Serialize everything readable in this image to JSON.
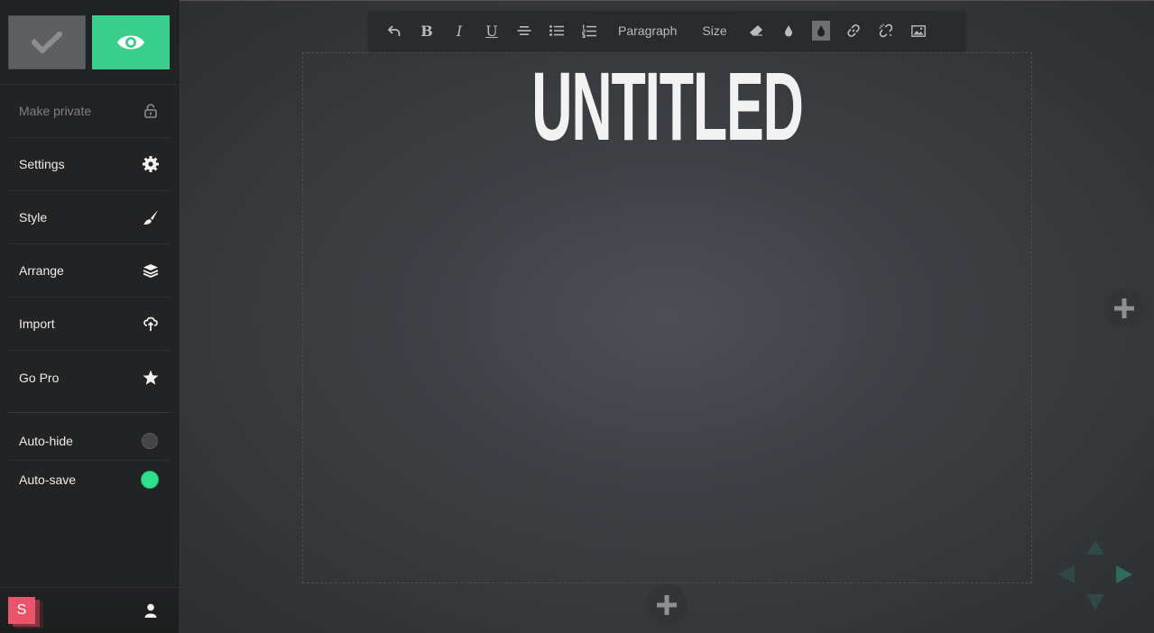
{
  "sidebar": {
    "menu": [
      {
        "label": "Make private",
        "icon": "lock-icon"
      },
      {
        "label": "Settings",
        "icon": "gear-icon"
      },
      {
        "label": "Style",
        "icon": "brush-icon"
      },
      {
        "label": "Arrange",
        "icon": "layers-icon"
      },
      {
        "label": "Import",
        "icon": "cloud-upload-icon"
      },
      {
        "label": "Go Pro",
        "icon": "star-icon"
      }
    ],
    "toggles": [
      {
        "label": "Auto-hide",
        "state": "off"
      },
      {
        "label": "Auto-save",
        "state": "on"
      }
    ],
    "footer": {
      "logo_letter": "S"
    }
  },
  "toolbar": {
    "bold": "B",
    "italic": "I",
    "underline": "U",
    "paragraph": "Paragraph",
    "size": "Size"
  },
  "canvas": {
    "title": "UNTITLED"
  },
  "colors": {
    "accent": "#3bcf8e",
    "toggle_on": "#2ee08c",
    "logo": "#e8546a"
  }
}
